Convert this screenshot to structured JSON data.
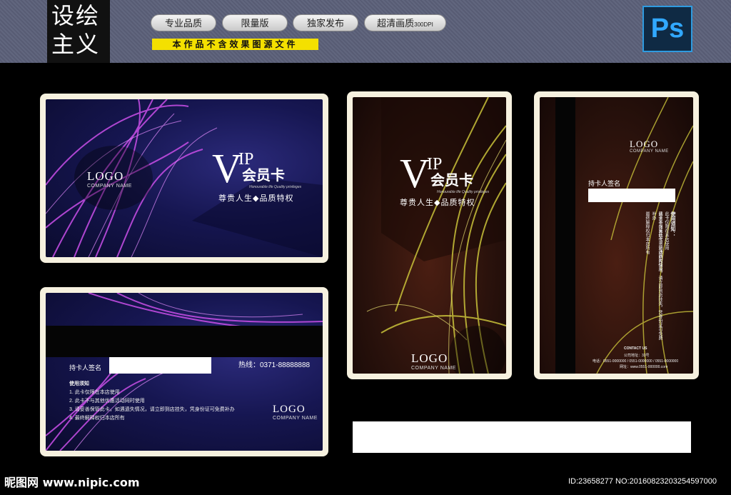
{
  "header": {
    "brand_line1": "设绘",
    "brand_line2": "主义",
    "pills": [
      "专业品质",
      "限量版",
      "独家发布",
      "超清画质"
    ],
    "pill_suffix": "300DPI",
    "notice": "本作品不含效果图源文件",
    "ps_label": "Ps"
  },
  "card_front": {
    "logo": "LOGO",
    "company": "COMPANY NAME",
    "vip_v": "V",
    "vip_ip": "IP",
    "vip_cn": "会员卡",
    "vip_en": "Honourable life Quality privileges",
    "slogan": "尊贵人生◆品质特权"
  },
  "card_back": {
    "sign_label": "持卡人签名",
    "hotline": "热线：0371-88888888",
    "rules_title": "使用须知",
    "rules": [
      "1. 此卡仅限在本店使用",
      "2. 此卡不与其他优惠活动同时使用",
      "3. 请妥善保管此卡，如遇遗失情况，请立即到店挂失，凭身份证可免费补办",
      "4. 最终解释权归本店所有"
    ],
    "logo": "LOGO",
    "company": "COMPANY NAME"
  },
  "card_vertical_front": {
    "vip_v": "V",
    "vip_ip": "IP",
    "vip_cn": "会员卡",
    "vip_en": "Honourable life Quality privileges",
    "slogan": "尊贵人生◆品质特权",
    "logo": "LOGO",
    "company": "COMPANY NAME"
  },
  "card_vertical_back": {
    "logo": "LOGO",
    "company": "COMPANY NAME",
    "sign_label": "持卡人签名",
    "rules_title": "使用须知：",
    "rules": [
      "此卡仅限在本店使用",
      "此卡不与其他优惠活动同时使用",
      "请妥善保管此卡，如遇遗失情况，请立即到店挂失，凭身份证可免费补办",
      "最终解释权归本店所有"
    ],
    "contact_title": "CONTACT US",
    "address": "公司地址：33号",
    "phone": "电话：0551-0000000 / 0551-0000000 / 0551-0000000",
    "website": "网址：www.0551-000000.com"
  },
  "footer": {
    "watermark": "昵图网 www.nipic.com",
    "id_line": "ID:23658277 NO:20160823203254597000"
  },
  "colors": {
    "header_bg": "#5b6079",
    "notice_bg": "#f4e000",
    "card_frame": "#f6f1df",
    "purple_swirl": "#c04ce0",
    "gold_swirl": "#c9c23a"
  }
}
